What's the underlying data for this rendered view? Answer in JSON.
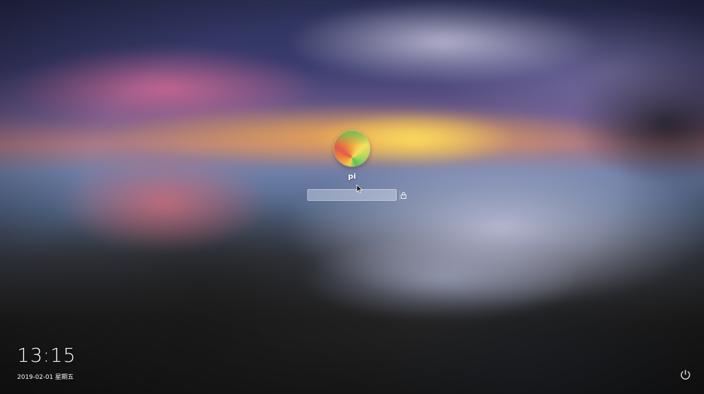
{
  "user": {
    "name": "pi",
    "avatar_icon": "flower-avatar"
  },
  "login": {
    "password_value": "",
    "password_placeholder": "",
    "submit_icon": "lock-icon"
  },
  "status": {
    "time": "13:15",
    "date": "2019-02-01 星期五"
  },
  "actions": {
    "power_icon": "power-icon"
  },
  "colors": {
    "text": "#ffffff",
    "input_bg": "rgba(235,240,255,0.38)"
  }
}
